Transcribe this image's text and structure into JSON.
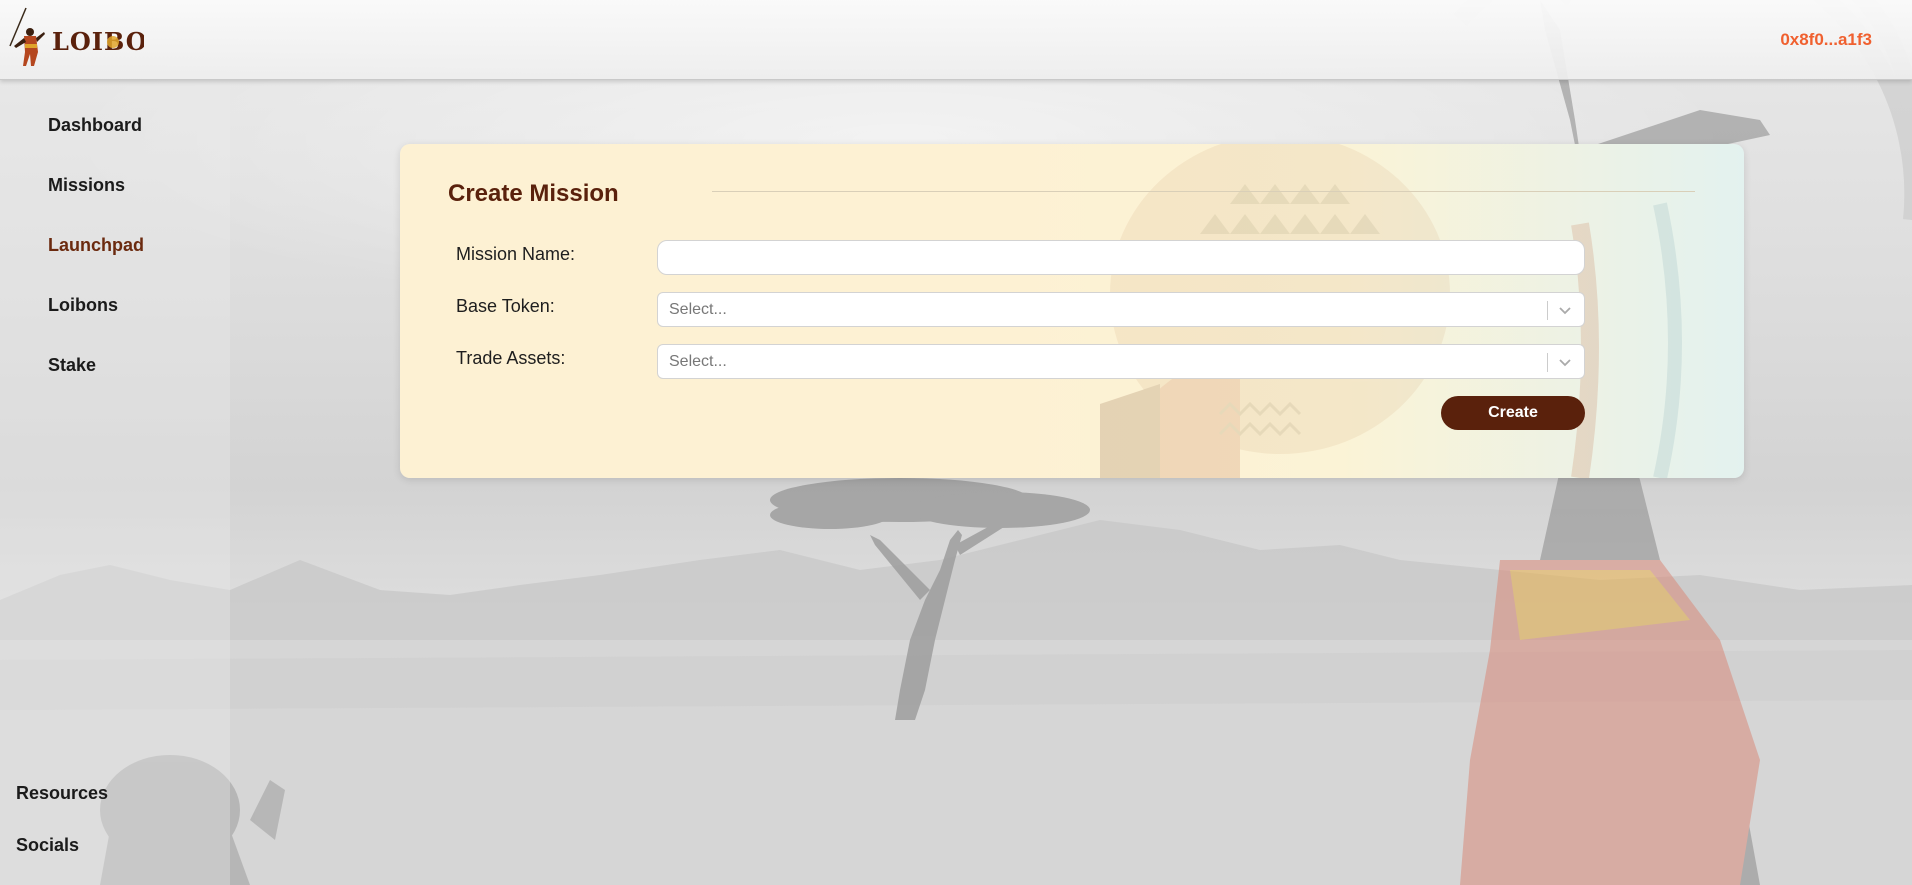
{
  "header": {
    "logo_text": "LOIBON",
    "wallet_address": "0x8f0...a1f3"
  },
  "sidebar": {
    "items": [
      {
        "label": "Dashboard"
      },
      {
        "label": "Missions"
      },
      {
        "label": "Launchpad",
        "active": true
      },
      {
        "label": "Loibons"
      },
      {
        "label": "Stake"
      }
    ],
    "footer": [
      {
        "label": "Resources"
      },
      {
        "label": "Socials"
      }
    ]
  },
  "form": {
    "title": "Create Mission",
    "mission_name_label": "Mission Name:",
    "mission_name_value": "",
    "base_token_label": "Base Token:",
    "base_token_placeholder": "Select...",
    "trade_assets_label": "Trade Assets:",
    "trade_assets_placeholder": "Select...",
    "create_label": "Create"
  },
  "colors": {
    "brand_dark": "#5a210c",
    "active_nav": "#6b2a0f",
    "wallet": "#f0602f"
  }
}
